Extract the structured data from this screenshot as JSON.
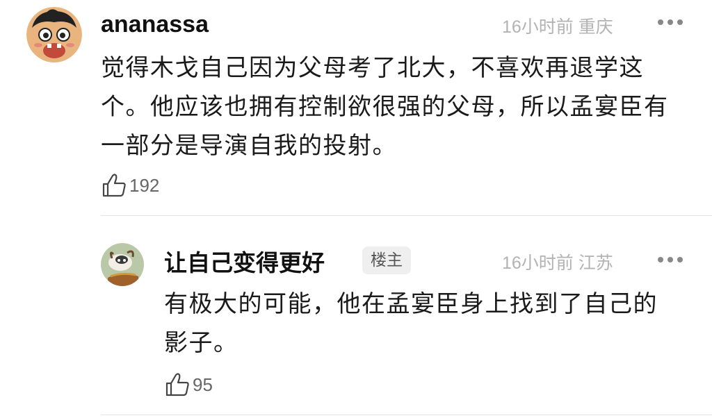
{
  "comments": [
    {
      "username": "ananassa",
      "time": "16小时前",
      "location": "重庆",
      "content": "觉得木戈自己因为父母考了北大，不喜欢再退学这个。他应该也拥有控制欲很强的父母，所以孟宴臣有一部分是导演自我的投射。",
      "likes": "192",
      "avatar_icon": "cartoon-face-avatar"
    },
    {
      "username": "让自己变得更好",
      "badge": "楼主",
      "time": "16小时前",
      "location": "江苏",
      "content": "有极大的可能，他在孟宴臣身上找到了自己的影子。",
      "likes": "95",
      "avatar_icon": "cow-toy-avatar"
    }
  ],
  "colors": {
    "meta_text": "#b3b3b3",
    "badge_bg": "#efefef",
    "divider": "#e6e6e6"
  }
}
